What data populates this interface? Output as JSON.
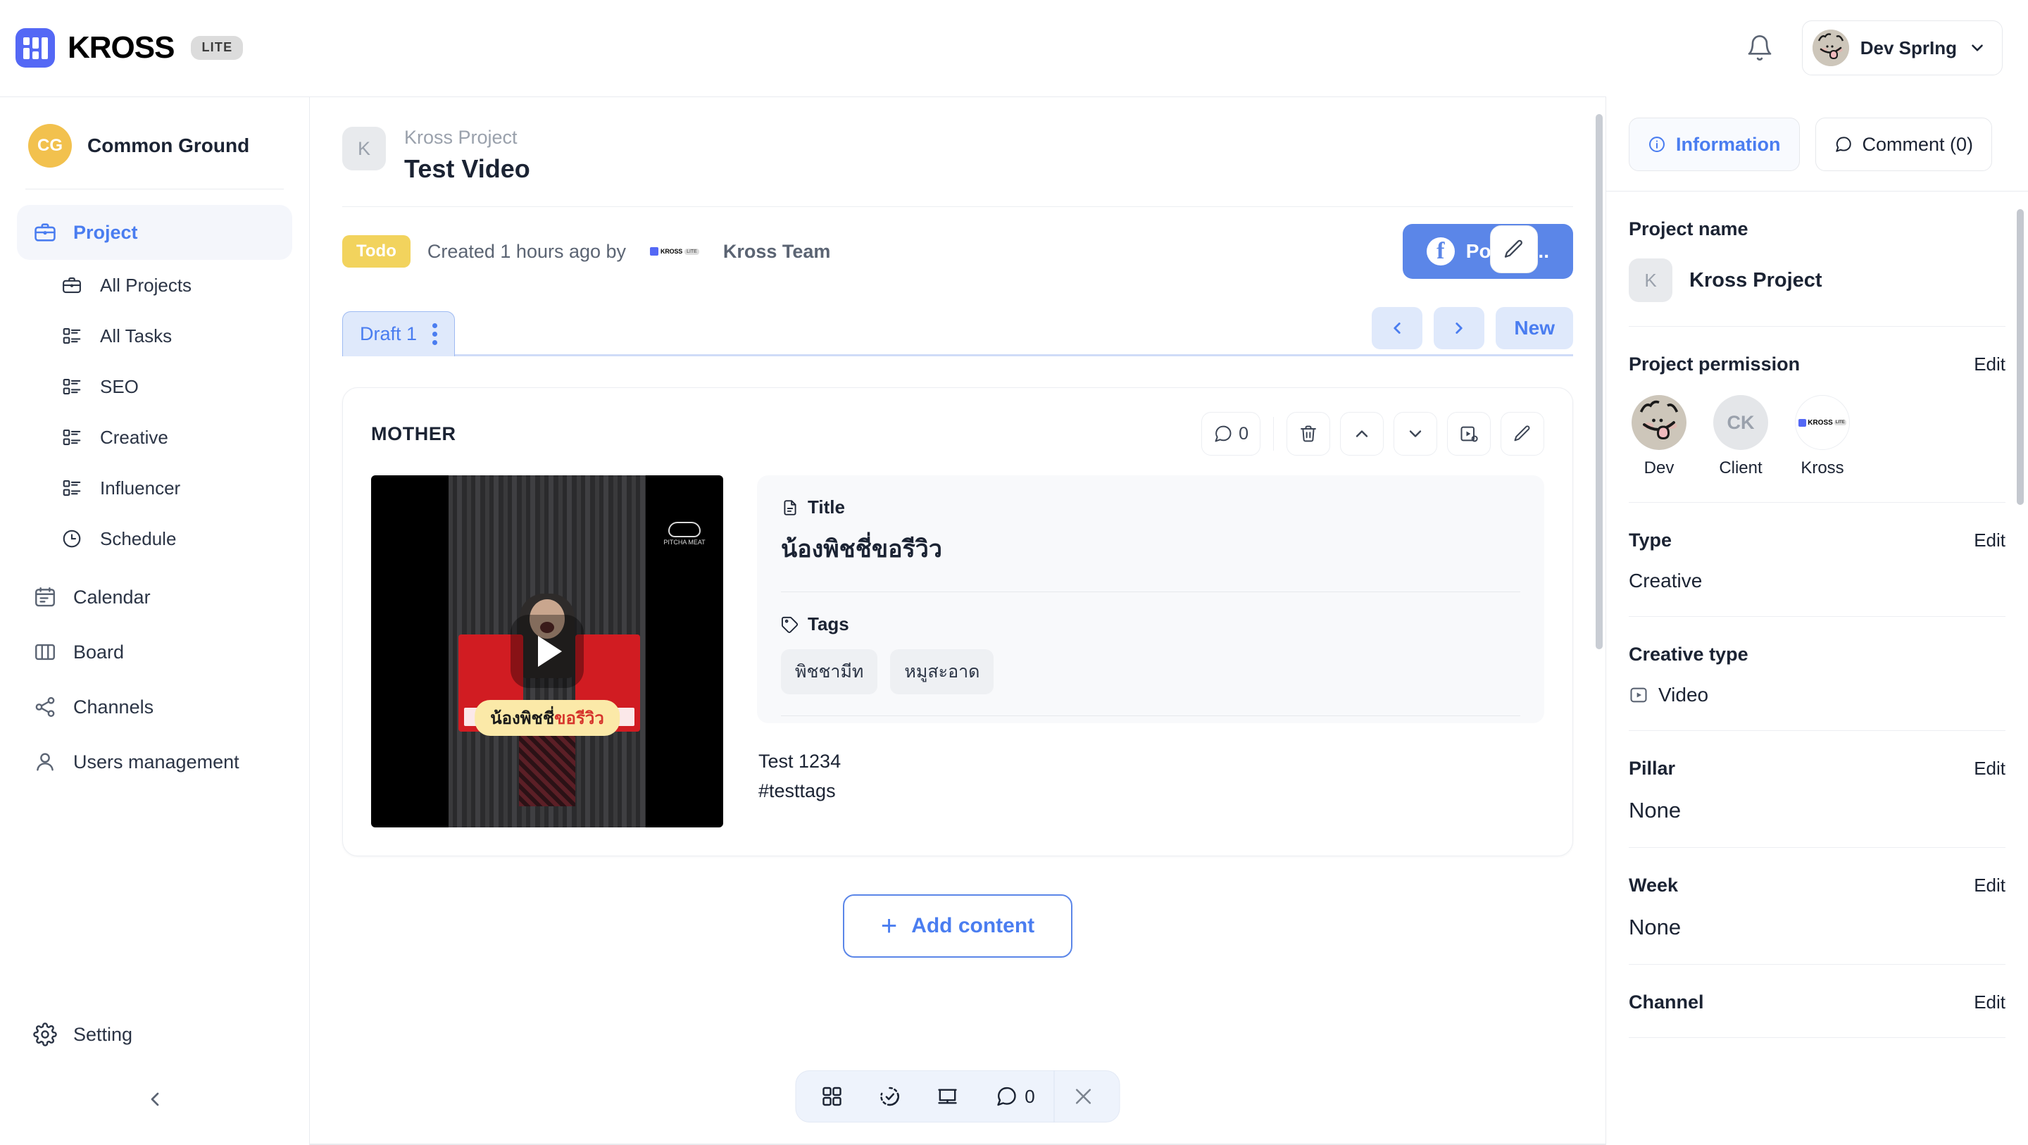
{
  "topbar": {
    "brand_name": "KROSS",
    "brand_badge": "LITE",
    "brand_icon": "kross-logo-icon",
    "bell_icon": "bell-icon",
    "user_name": "Dev SprIng",
    "user_chevron": "chevron-down-icon"
  },
  "sidebar": {
    "workspace": {
      "initials": "CG",
      "name": "Common Ground"
    },
    "items": [
      {
        "label": "Project",
        "icon": "briefcase-icon",
        "active": true
      },
      {
        "label": "All Projects",
        "icon": "briefcase-icon",
        "sub": true
      },
      {
        "label": "All Tasks",
        "icon": "task-list-icon",
        "sub": true
      },
      {
        "label": "SEO",
        "icon": "task-list-icon",
        "sub": true
      },
      {
        "label": "Creative",
        "icon": "task-list-icon",
        "sub": true
      },
      {
        "label": "Influencer",
        "icon": "task-list-icon",
        "sub": true
      },
      {
        "label": "Schedule",
        "icon": "clock-icon",
        "sub": true
      },
      {
        "label": "Calendar",
        "icon": "calendar-icon"
      },
      {
        "label": "Board",
        "icon": "board-columns-icon"
      },
      {
        "label": "Channels",
        "icon": "share-nodes-icon"
      },
      {
        "label": "Users management",
        "icon": "user-icon"
      }
    ],
    "setting_label": "Setting",
    "setting_icon": "gear-icon",
    "collapse_icon": "chevron-left-icon"
  },
  "main": {
    "breadcrumb": "Kross Project",
    "title": "Test Video",
    "thumb_initial": "K",
    "edit_icon": "pencil-icon",
    "status_badge": "Todo",
    "created_text": "Created 1 hours ago by",
    "author": "Kross Team",
    "author_logo_text": "KROSS",
    "author_logo_badge": "LITE",
    "post_button": "Post to...",
    "post_icon": "facebook-icon",
    "tabs": [
      {
        "label": "Draft 1",
        "menu_icon": "kebab-menu-icon",
        "active": true
      }
    ],
    "pagination": {
      "prev": "‹",
      "next": "›",
      "new_label": "New"
    },
    "card": {
      "label": "MOTHER",
      "tools": [
        {
          "name": "comment-icon",
          "count": "0"
        },
        {
          "name": "trash-icon"
        },
        {
          "name": "chevron-up-icon"
        },
        {
          "name": "chevron-down-icon"
        },
        {
          "name": "video-settings-icon"
        },
        {
          "name": "pencil-icon"
        }
      ],
      "video": {
        "play_icon": "play-icon",
        "caption_black": "น้องพิชชี่",
        "caption_red": "ขอรีวิว",
        "watermark": "PITCHA MEAT"
      },
      "title_label": "Title",
      "title_icon": "document-icon",
      "title_value": "น้องพิชชี่ขอรีวิว",
      "tags_label": "Tags",
      "tags_icon": "tag-icon",
      "tags": [
        "พิชชามีท",
        "หมูสะอาด"
      ],
      "description_line1": "Test 1234",
      "description_line2": "#testtags"
    },
    "add_content_label": "Add content",
    "add_content_icon": "plus-icon",
    "float_bar": [
      {
        "name": "grid-icon"
      },
      {
        "name": "history-icon"
      },
      {
        "name": "presentation-icon"
      },
      {
        "name": "comment-icon",
        "count": "0"
      },
      {
        "name": "close-icon"
      }
    ]
  },
  "right_panel": {
    "tabs": [
      {
        "label": "Information",
        "icon": "info-icon",
        "active": true
      },
      {
        "label": "Comment (0)",
        "icon": "comment-icon",
        "active": false
      }
    ],
    "sections": [
      {
        "title": "Project name",
        "edit": "",
        "project_initial": "K",
        "project_name": "Kross Project"
      },
      {
        "title": "Project permission",
        "edit": "Edit",
        "members": [
          {
            "name": "Dev",
            "type": "photo"
          },
          {
            "name": "Client",
            "type": "initials",
            "initials": "CK"
          },
          {
            "name": "Kross",
            "type": "logo",
            "logo_text": "KROSS",
            "logo_badge": "LITE"
          }
        ]
      },
      {
        "title": "Type",
        "edit": "Edit",
        "value": "Creative"
      },
      {
        "title": "Creative type",
        "edit": "",
        "value": "Video",
        "value_icon": "video-play-icon"
      },
      {
        "title": "Pillar",
        "edit": "Edit",
        "value": "None",
        "big": true
      },
      {
        "title": "Week",
        "edit": "Edit",
        "value": "None",
        "big": true
      },
      {
        "title": "Channel",
        "edit": "Edit",
        "value": ""
      }
    ]
  },
  "colors": {
    "accent": "#4a7df0",
    "accent_button": "#5b86e8",
    "brand": "#5468f5",
    "status_todo": "#f2d35d",
    "workspace_avatar": "#f2c14e",
    "tab_bg": "#dfe9fb"
  }
}
